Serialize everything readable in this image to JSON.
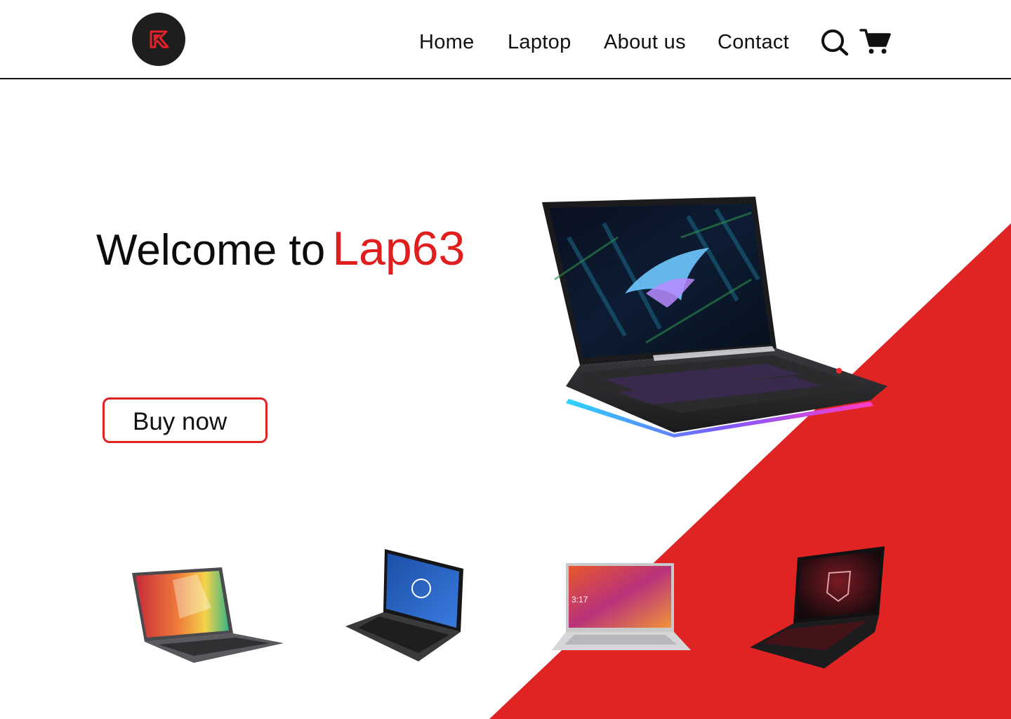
{
  "nav": {
    "items": [
      {
        "label": "Home"
      },
      {
        "label": "Laptop"
      },
      {
        "label": "About us"
      },
      {
        "label": "Contact"
      }
    ],
    "icons": [
      "search-icon",
      "cart-icon"
    ]
  },
  "logo": {
    "letter": "K",
    "icon": "lap63-logo"
  },
  "hero": {
    "welcome": "Welcome to",
    "brand": "Lap63",
    "button_label": "Buy now"
  },
  "colors": {
    "accent": "#e02424",
    "dark": "#1e1e1e",
    "background": "#ffffff"
  },
  "products": [
    {
      "icon": "laptop-vivobook-image"
    },
    {
      "icon": "laptop-dell-xps-image"
    },
    {
      "icon": "laptop-asus-silver-image"
    },
    {
      "icon": "laptop-msi-gaming-image"
    }
  ],
  "main_product": {
    "icon": "laptop-rog-gaming-image"
  }
}
